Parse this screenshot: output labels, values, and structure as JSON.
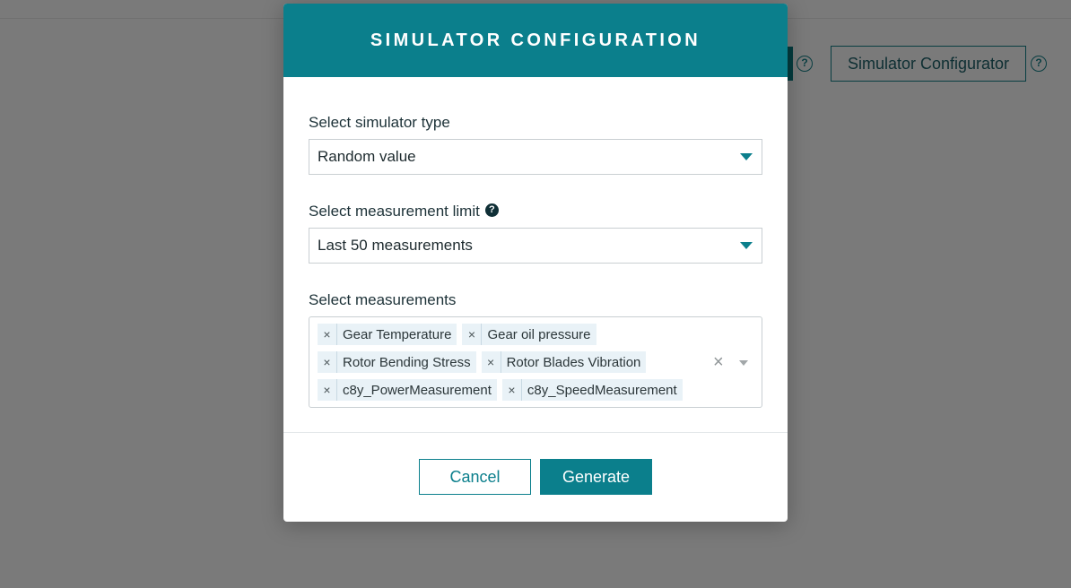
{
  "background": {
    "help_glyph": "?",
    "configurator_label": "Simulator Configurator"
  },
  "modal": {
    "title": "SIMULATOR CONFIGURATION",
    "simulator_type": {
      "label": "Select simulator type",
      "value": "Random value"
    },
    "measurement_limit": {
      "label": "Select measurement limit",
      "info_glyph": "?",
      "value": "Last 50 measurements"
    },
    "measurements": {
      "label": "Select measurements",
      "remove_glyph": "×",
      "clear_glyph": "×",
      "selected": [
        "Gear Temperature",
        "Gear oil pressure",
        "Rotor Bending Stress",
        "Rotor Blades Vibration",
        "c8y_PowerMeasurement",
        "c8y_SpeedMeasurement"
      ]
    },
    "buttons": {
      "cancel": "Cancel",
      "generate": "Generate"
    }
  },
  "colors": {
    "accent": "#0b7f8c",
    "overlay": "#7a7a7a",
    "tag_bg": "#e9f2f7"
  }
}
